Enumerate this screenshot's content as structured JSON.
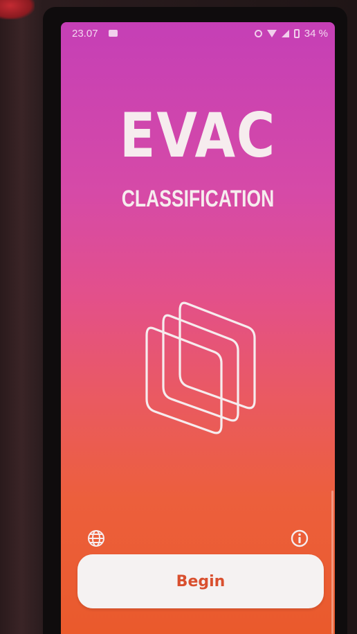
{
  "status_bar": {
    "time": "23.07",
    "battery": "34 %",
    "icons": [
      "media-icon",
      "alarm-icon",
      "wifi-icon",
      "signal-icon",
      "battery-icon"
    ]
  },
  "app": {
    "logo_text": "EVAC",
    "subtitle": "CLASSIFICATION",
    "logo_icon": "layered-squares-icon"
  },
  "actions": {
    "language_icon": "globe-icon",
    "info_icon": "info-icon",
    "begin_label": "Begin"
  },
  "colors": {
    "gradient_top": "#c53fb6",
    "gradient_bottom": "#ea5a2c",
    "text": "#f6ecee",
    "button_bg": "#f5f2f2",
    "button_text": "#d9502f"
  }
}
